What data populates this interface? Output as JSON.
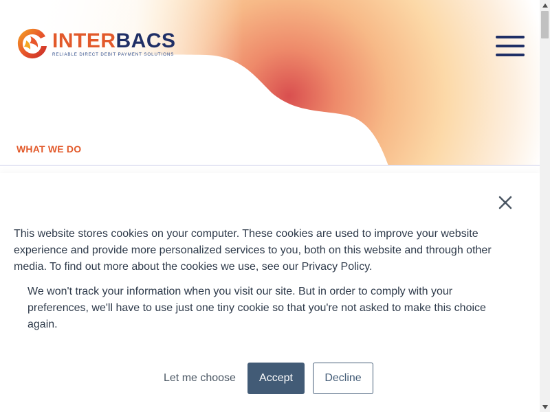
{
  "header": {
    "logo": {
      "word_part1": "INTER",
      "word_part2": "BACS",
      "tagline": "RELIABLE DIRECT DEBIT PAYMENT SOLUTIONS",
      "icon": "phoenix-logo-mark"
    },
    "menu_icon": "hamburger-menu-icon"
  },
  "hero": {
    "section_link": "WHAT WE DO"
  },
  "cookie_banner": {
    "close_icon": "close-icon",
    "text": "This website stores cookies on your computer. These cookies are used to improve your website experience and provide more personalized services to you, both on this website and through other media. To find out more about the cookies we use, see our Privacy Policy.",
    "subtext": "We won't track your information when you visit our site. But in order to comply with your preferences, we'll have to use just one tiny cookie so that you're not asked to make this choice again.",
    "buttons": {
      "choose": "Let me choose",
      "accept": "Accept",
      "decline": "Decline"
    }
  },
  "colors": {
    "brand_orange": "#e2592a",
    "brand_navy": "#1f2f66",
    "button_slate": "#425b76"
  }
}
